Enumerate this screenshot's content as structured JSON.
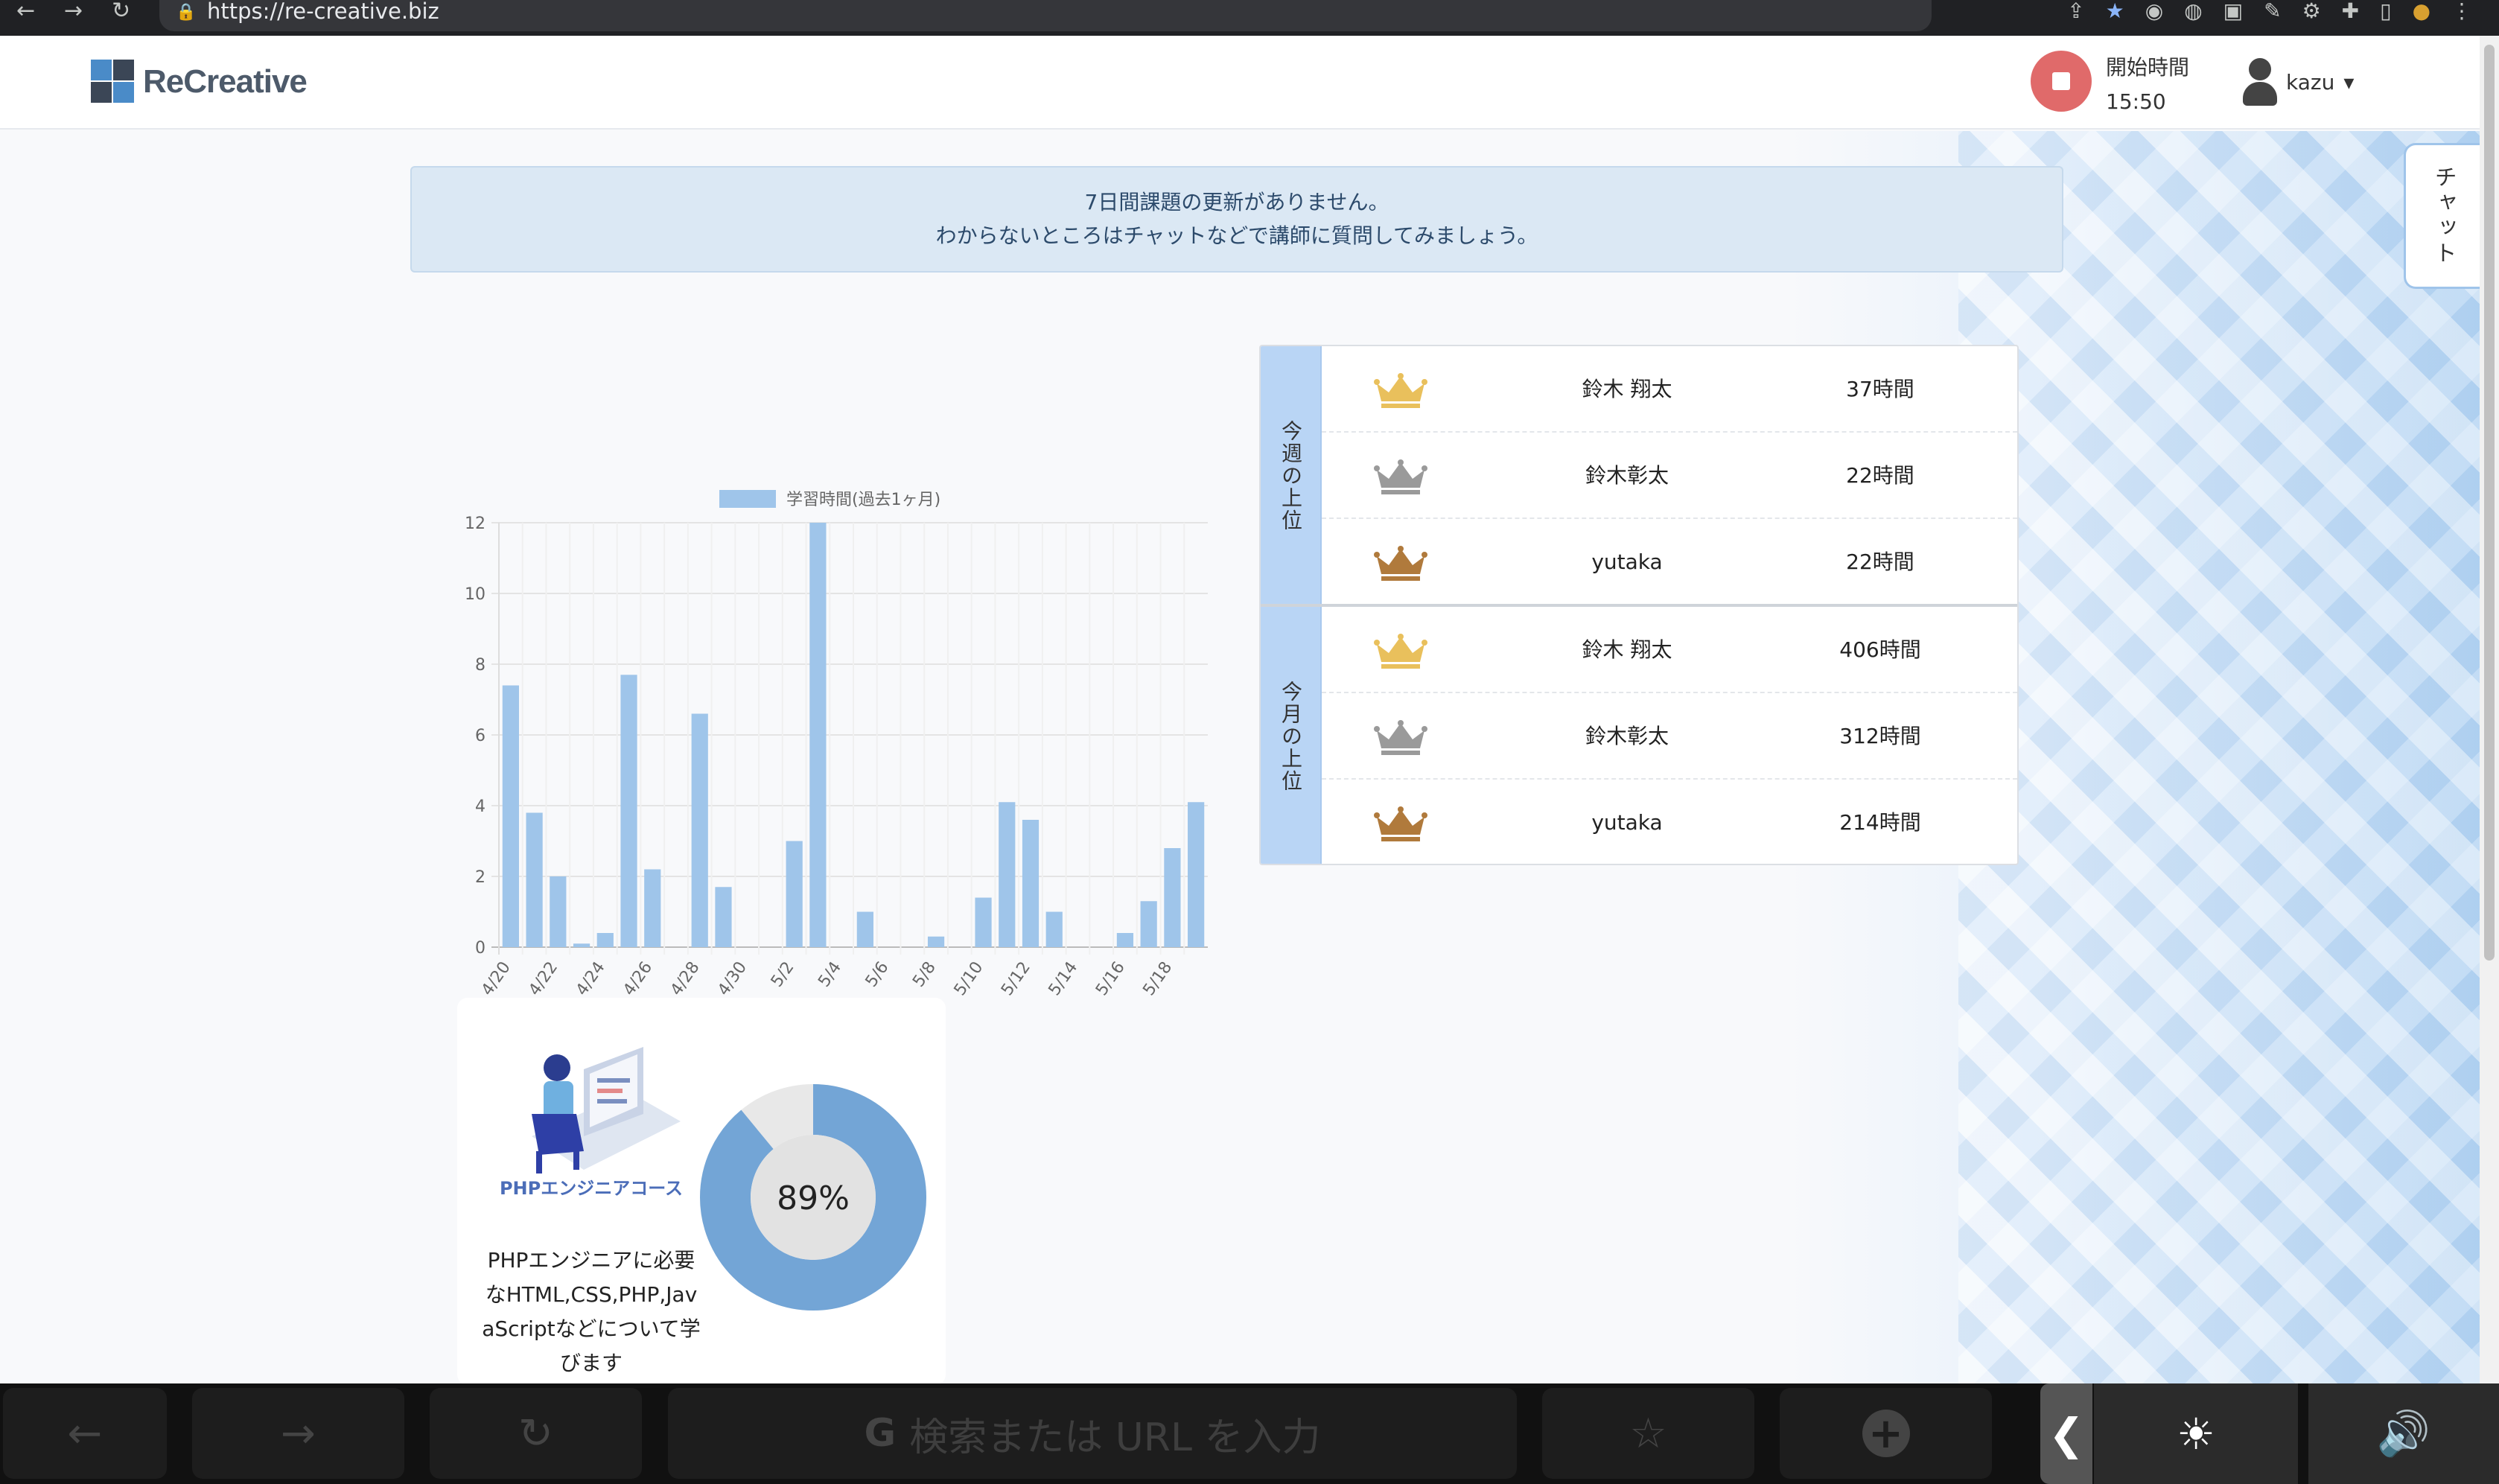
{
  "browser": {
    "url": "https://re-creative.biz",
    "nav_back": "←",
    "nav_forward": "→",
    "nav_reload": "↻",
    "lock": "🔒",
    "ext_icons": [
      "share-icon",
      "star-icon",
      "extension-a-icon",
      "line-icon",
      "extension-b-icon",
      "pen-icon",
      "gear-icon",
      "puzzle-icon",
      "sidepanel-icon",
      "profile-icon",
      "menu-icon"
    ]
  },
  "header": {
    "brand": "ReCreative",
    "timer_label": "開始時間",
    "timer_value": "15:50",
    "user_name": "kazu",
    "user_caret": "▾"
  },
  "notice": {
    "line1": "7日間課題の更新がありません。",
    "line2": "わからないところはチャットなどで講師に質問してみましょう。"
  },
  "chat_tab": "チャット",
  "chart_data": {
    "type": "bar",
    "legend": "学習時間(過去1ヶ月)",
    "categories": [
      "4/20",
      "4/21",
      "4/22",
      "4/23",
      "4/24",
      "4/25",
      "4/26",
      "4/27",
      "4/28",
      "4/29",
      "4/30",
      "5/1",
      "5/2",
      "5/3",
      "5/4",
      "5/5",
      "5/6",
      "5/7",
      "5/8",
      "5/9",
      "5/10",
      "5/11",
      "5/12",
      "5/13",
      "5/14",
      "5/15",
      "5/16",
      "5/17",
      "5/18",
      "5/19"
    ],
    "tick_labels": [
      "4/20",
      "4/22",
      "4/24",
      "4/26",
      "4/28",
      "4/30",
      "5/2",
      "5/4",
      "5/6",
      "5/8",
      "5/10",
      "5/12",
      "5/14",
      "5/16",
      "5/18"
    ],
    "values": [
      7.4,
      3.8,
      2.0,
      0.1,
      0.4,
      7.7,
      2.2,
      0,
      6.6,
      1.7,
      0,
      0,
      3.0,
      12.0,
      0,
      1.0,
      0,
      0,
      0.3,
      0,
      1.4,
      4.1,
      3.6,
      1.0,
      0,
      0,
      0.4,
      1.3,
      2.8,
      4.1
    ],
    "ylim": [
      0,
      12
    ],
    "yticks": [
      0,
      2,
      4,
      6,
      8,
      10,
      12
    ],
    "grid": true,
    "legend_position": "top",
    "color": "#9fc5ea"
  },
  "ranking": {
    "weekly_label": "今週の上位",
    "monthly_label": "今月の上位",
    "weekly": [
      {
        "name": "鈴木 翔太",
        "hours": "37時間",
        "medal": "gold"
      },
      {
        "name": "鈴木彰太",
        "hours": "22時間",
        "medal": "silver"
      },
      {
        "name": "yutaka",
        "hours": "22時間",
        "medal": "bronze"
      }
    ],
    "monthly": [
      {
        "name": "鈴木 翔太",
        "hours": "406時間",
        "medal": "gold"
      },
      {
        "name": "鈴木彰太",
        "hours": "312時間",
        "medal": "silver"
      },
      {
        "name": "yutaka",
        "hours": "214時間",
        "medal": "bronze"
      }
    ],
    "medal_colors": {
      "gold": "#e9c05c",
      "silver": "#9a9a9a",
      "bronze": "#b07a3c"
    }
  },
  "course": {
    "title": "PHPエンジニアコース",
    "description": "PHPエンジニアに必要なHTML,CSS,PHP,JavaScriptなどについて学びます",
    "progress_label": "89%",
    "progress": 0.89,
    "ring_color": "#73a5d6",
    "rest_color": "#e8e8e8"
  },
  "bottom_bar": {
    "back": "←",
    "forward": "→",
    "reload": "↻",
    "search_g": "G",
    "search_placeholder": "検索または URL を入力",
    "bookmark": "☆",
    "new_tab": "+",
    "collapse": "❮",
    "brightness": "☀",
    "volume": "🔊"
  }
}
